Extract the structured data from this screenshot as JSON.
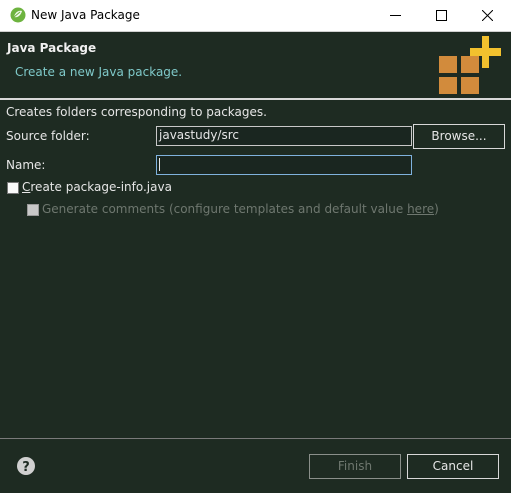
{
  "window": {
    "title": "New Java Package",
    "app_icon": "eclipse-spring-icon"
  },
  "window_controls": {
    "minimize": "minimize-icon",
    "maximize": "maximize-icon",
    "close": "close-icon"
  },
  "banner": {
    "title": "Java Package",
    "subtitle": "Create a new Java package.",
    "icon": "package-wizard-icon"
  },
  "form": {
    "info": "Creates folders corresponding to packages.",
    "source_folder_label": "Source folder:",
    "source_folder_value": "javastudy/src",
    "browse_label": "Browse...",
    "name_label": "Name:",
    "name_value": "",
    "create_info_checked": false,
    "create_info_label_mnemonic": "C",
    "create_info_label_rest": "reate package-info.java",
    "generate_comments_checked": false,
    "generate_comments_label": "Generate comments (configure templates and default value ",
    "generate_comments_link": "here",
    "generate_comments_close": ")"
  },
  "footer": {
    "help_icon": "help-icon",
    "finish_label": "Finish",
    "cancel_label": "Cancel"
  },
  "colors": {
    "background": "#1e2b22",
    "accent_text": "#7fc9c9",
    "logo_orange": "#d28b3c",
    "logo_plus": "#f2c12e"
  }
}
